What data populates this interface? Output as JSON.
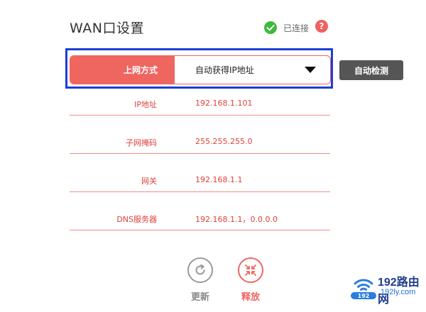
{
  "header": {
    "title": "WAN口设置",
    "status_text": "已连接",
    "help_symbol": "?"
  },
  "connection_mode": {
    "label": "上网方式",
    "selected_value": "自动获得IP地址",
    "auto_detect_label": "自动检测"
  },
  "fields": [
    {
      "label": "IP地址",
      "value": "192.168.1.101"
    },
    {
      "label": "子网掩码",
      "value": "255.255.255.0"
    },
    {
      "label": "网关",
      "value": "192.168.1.1"
    },
    {
      "label": "DNS服务器",
      "value": "192.168.1.1，0.0.0.0"
    }
  ],
  "actions": {
    "refresh_label": "更新",
    "release_label": "释放"
  },
  "watermark": {
    "brand": "192路由网",
    "domain": "192ly.com"
  },
  "colors": {
    "accent": "#ef6560",
    "field_text": "#e0413b",
    "highlight_box": "#1a3fd6",
    "status_ok": "#3dbb3d",
    "button_dark": "#555555"
  },
  "icons": {
    "status": "check-circle-icon",
    "help": "question-icon",
    "dropdown": "chevron-down-icon",
    "refresh": "refresh-icon",
    "release": "collapse-arrows-icon",
    "logo": "wifi-logo-icon"
  }
}
